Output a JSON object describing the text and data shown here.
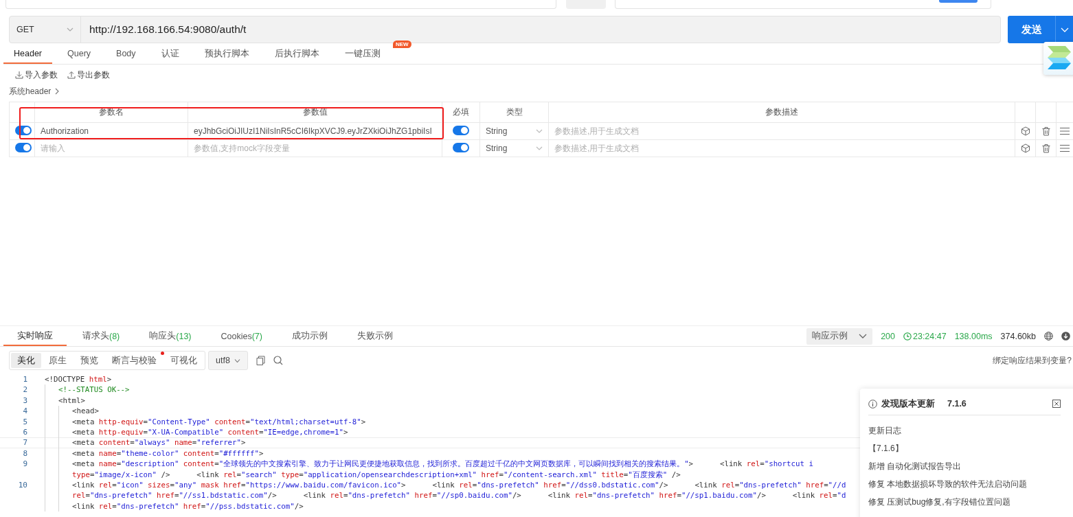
{
  "request": {
    "method": "GET",
    "url": "http://192.168.166.54:9080/auth/t",
    "send_label": "发送"
  },
  "tabs": [
    {
      "label": "Header",
      "selected": true
    },
    {
      "label": "Query",
      "selected": false
    },
    {
      "label": "Body",
      "selected": false
    },
    {
      "label": "认证",
      "selected": false
    },
    {
      "label": "预执行脚本",
      "selected": false
    },
    {
      "label": "后执行脚本",
      "selected": false
    },
    {
      "label": "一键压测",
      "selected": false,
      "badge": "NEW"
    }
  ],
  "param_actions": [
    {
      "kind": "import",
      "label": "导入参数"
    },
    {
      "kind": "export",
      "label": "导出参数"
    }
  ],
  "system_header": "系统header",
  "params": {
    "columns": [
      "参数名",
      "参数值",
      "必填",
      "类型",
      "参数描述"
    ],
    "rows": [
      {
        "enabled": true,
        "name": "Authorization",
        "value": "eyJhbGciOiJIUzI1NiIsInR5cCI6IkpXVCJ9.eyJrZXkiOiJhZG1pbiIsI",
        "required": true,
        "type": "String",
        "description_placeholder": "参数描述,用于生成文档"
      },
      {
        "enabled": true,
        "name_placeholder": "请输入",
        "value_placeholder": "参数值,支持mock字段变量",
        "required": true,
        "type": "String",
        "description_placeholder": "参数描述,用于生成文档"
      }
    ]
  },
  "response": {
    "tabs": [
      {
        "label": "实时响应",
        "selected": true
      },
      {
        "label": "请求头",
        "count": "(8)",
        "selected": false
      },
      {
        "label": "响应头",
        "count": "(13)",
        "selected": false
      },
      {
        "label": "Cookies",
        "count": "(7)",
        "selected": false
      },
      {
        "label": "成功示例",
        "selected": false
      },
      {
        "label": "失败示例",
        "selected": false
      }
    ],
    "example_select": "响应示例",
    "status": "200",
    "time": "23:24:47",
    "duration": "138.00ms",
    "size": "374.60kb",
    "views": [
      {
        "label": "美化",
        "selected": true,
        "dot": false
      },
      {
        "label": "原生",
        "selected": false,
        "dot": false
      },
      {
        "label": "预览",
        "selected": false,
        "dot": false
      },
      {
        "label": "断言与校验",
        "selected": false,
        "dot": true
      },
      {
        "label": "可视化",
        "selected": false,
        "dot": false
      }
    ],
    "encoding": "utf8",
    "bind_link": "绑定响应结果到变量?",
    "code": [
      {
        "number": "1",
        "text": "<!DOCTYPE html>",
        "children": [
          {
            "number": "2",
            "text": "<!--STATUS OK-->"
          },
          {
            "number": "3",
            "text": "<html>",
            "children": [
              {
                "number": "4",
                "text": "<head>"
              },
              {
                "number": "5",
                "text": "<meta http-equiv=\"Content-Type\" content=\"text/html;charset=utf-8\">"
              },
              {
                "number": "6",
                "text": "<meta http-equiv=\"X-UA-Compatible\" content=\"IE=edge,chrome=1\">"
              },
              {
                "number": "7",
                "text": "<meta content=\"always\" name=\"referrer\">"
              },
              {
                "number": "8",
                "text": "<meta name=\"theme-color\" content=\"#ffffff\">"
              },
              {
                "number": "9",
                "text": "<meta name=\"description\" content=\"全球领先的中文搜索引擎、致力于让网民更便捷地获取信息，找到所求。百度超过千亿的中文网页数据库，可以瞬间找到相关的搜索结果。\">      <link rel=\"shortcut i",
                "wrapped": [
                  "type=\"image/x-icon\" />      <link rel=\"search\" type=\"application/opensearchdescription+xml\" href=\"/content-search.xml\" title=\"百度搜索\" />"
                ]
              },
              {
                "number": "10",
                "text": "<link rel=\"icon\" sizes=\"any\" mask href=\"https://www.baidu.com/favicon.ico\">      <link rel=\"dns-prefetch\" href=\"//dss0.bdstatic.com\"/>      <link rel=\"dns-prefetch\" href=\"//d",
                "wrapped": [
                  "rel=\"dns-prefetch\" href=\"//ss1.bdstatic.com\"/>      <link rel=\"dns-prefetch\" href=\"//sp0.baidu.com\"/>      <link rel=\"dns-prefetch\" href=\"//sp1.baidu.com\"/>      <link rel=\"d",
                  "<link rel=\"dns-prefetch\" href=\"//pss.bdstatic.com\"/>"
                ]
              }
            ]
          }
        ]
      }
    ]
  },
  "update_popup": {
    "title": "发现版本更新",
    "version": "7.1.6",
    "lines": [
      "更新日志",
      "【7.1.6】",
      "新增 自动化测试报告导出",
      "修复 本地数据损坏导致的软件无法启动问题",
      "修复 压测试bug修复,有字段错位置问题"
    ]
  }
}
